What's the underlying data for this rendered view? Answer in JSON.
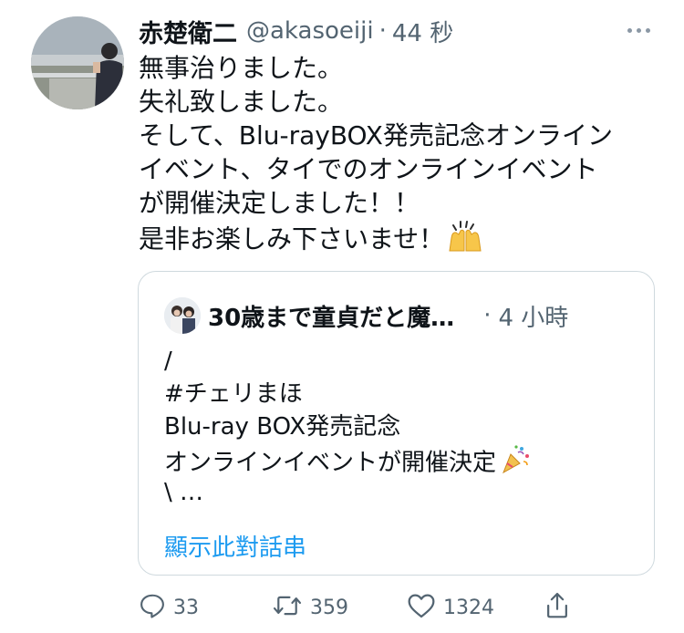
{
  "tweet": {
    "display_name": "赤楚衛二",
    "handle": "@akasoeiji",
    "separator": "·",
    "time": "44 秒",
    "lines": [
      "無事治りました。",
      "失礼致しました。",
      "そして、Blu-rayBOX発売記念オンライン",
      "イベント、タイでのオンラインイベント",
      "が開催決定しました！！",
      "是非お楽しみ下さいませ！"
    ],
    "line_emoji_icon": "raising-hands-icon"
  },
  "quote": {
    "name": "30歳まで童貞だと魔…",
    "separator": "·",
    "time": "4 小時",
    "lines": [
      "/",
      "#チェリまほ",
      "Blu-ray BOX発売記念",
      "オンラインイベントが開催決定",
      "\\ …"
    ],
    "line_emoji_icon": "party-popper-icon",
    "show_thread": "顯示此對話串"
  },
  "actions": {
    "reply_count": "33",
    "retweet_count": "359",
    "like_count": "1324"
  },
  "colors": {
    "text": "#0f1419",
    "secondary": "#536471",
    "link": "#1d9bf0",
    "border": "#cfd9de"
  }
}
